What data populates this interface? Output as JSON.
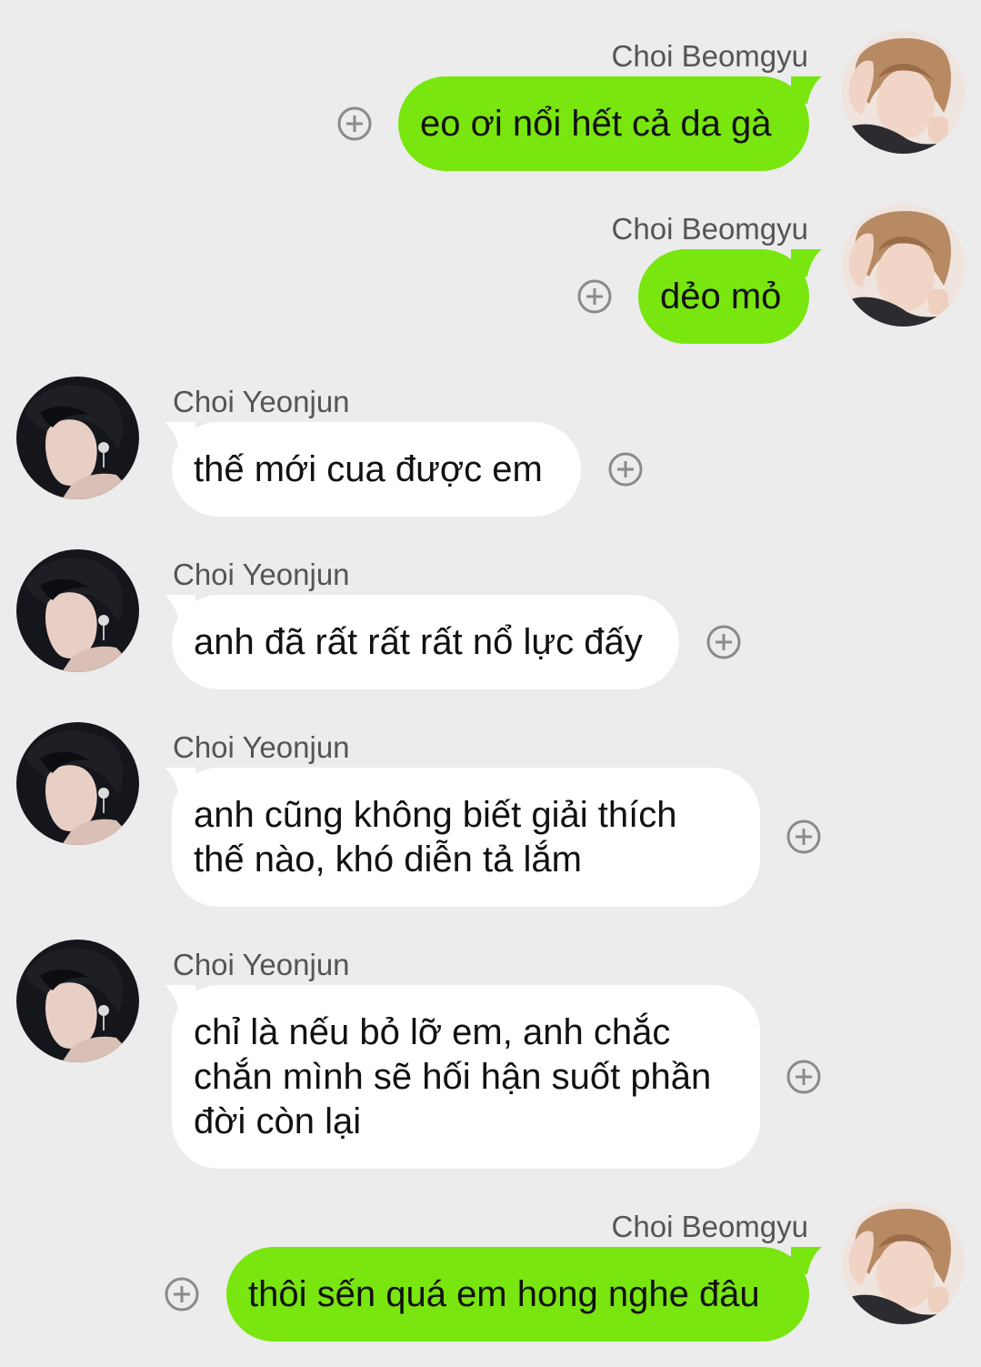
{
  "colors": {
    "background": "#ececec",
    "sent_bubble": "#79e610",
    "received_bubble": "#ffffff",
    "name_text": "#555555"
  },
  "messages": [
    {
      "direction": "sent",
      "sender": "Choi Beomgyu",
      "text": "eo ơi nổi hết cả da gà",
      "avatar": "beomgyu-avatar",
      "action_icon": "add-circle-icon"
    },
    {
      "direction": "sent",
      "sender": "Choi Beomgyu",
      "text": "dẻo mỏ",
      "avatar": "beomgyu-avatar",
      "action_icon": "add-circle-icon"
    },
    {
      "direction": "received",
      "sender": "Choi Yeonjun",
      "text": "thế mới cua được em",
      "avatar": "yeonjun-avatar",
      "action_icon": "add-circle-icon"
    },
    {
      "direction": "received",
      "sender": "Choi Yeonjun",
      "text": "anh đã rất rất rất nổ lực đấy",
      "avatar": "yeonjun-avatar",
      "action_icon": "add-circle-icon"
    },
    {
      "direction": "received",
      "sender": "Choi Yeonjun",
      "text": "anh cũng không biết giải thích thế nào, khó diễn tả lắm",
      "avatar": "yeonjun-avatar",
      "action_icon": "add-circle-icon"
    },
    {
      "direction": "received",
      "sender": "Choi Yeonjun",
      "text": "chỉ là nếu bỏ lỡ em, anh chắc chắn mình sẽ hối hận suốt phần đời còn lại",
      "avatar": "yeonjun-avatar",
      "action_icon": "add-circle-icon"
    },
    {
      "direction": "sent",
      "sender": "Choi Beomgyu",
      "text": "thôi sến quá em hong nghe đâu",
      "avatar": "beomgyu-avatar",
      "action_icon": "add-circle-icon"
    }
  ]
}
